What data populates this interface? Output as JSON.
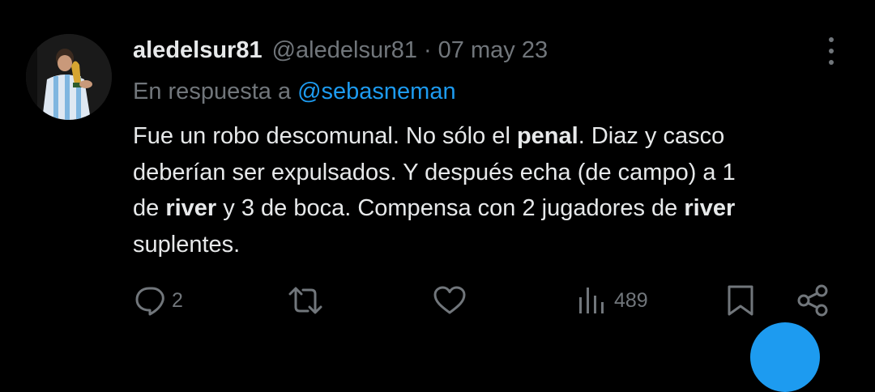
{
  "tweet": {
    "display_name": "aledelsur81",
    "handle": "@aledelsur81",
    "separator": "·",
    "date": "07 may 23",
    "reply_prefix": "En respuesta a",
    "reply_mention": "@sebasneman",
    "body_lines": [
      [
        {
          "text": "Fue un robo descomunal. No sólo el ",
          "bold": false
        },
        {
          "text": "penal",
          "bold": true
        },
        {
          "text": ". Diaz y casco",
          "bold": false
        }
      ],
      [
        {
          "text": "deberían ser expulsados. Y después echa (de campo) a 1",
          "bold": false
        }
      ],
      [
        {
          "text": "de ",
          "bold": false
        },
        {
          "text": "river",
          "bold": true
        },
        {
          "text": " y 3 de boca. Compensa con 2 jugadores de ",
          "bold": false
        },
        {
          "text": "river",
          "bold": true
        }
      ],
      [
        {
          "text": "suplentes.",
          "bold": false
        }
      ]
    ],
    "actions": {
      "reply_count": "2",
      "retweet_count": "",
      "like_count": "",
      "views_count": "489"
    }
  },
  "icons": {
    "reply": "speech-bubble-icon",
    "retweet": "retweet-arrows-icon",
    "like": "heart-icon",
    "views": "bar-chart-icon",
    "bookmark": "bookmark-icon",
    "share": "share-icon",
    "more": "vertical-ellipsis-icon"
  },
  "colors": {
    "background": "#000000",
    "primary_text": "#e7e9ea",
    "secondary_text": "#71767b",
    "accent": "#1d9bf0"
  }
}
